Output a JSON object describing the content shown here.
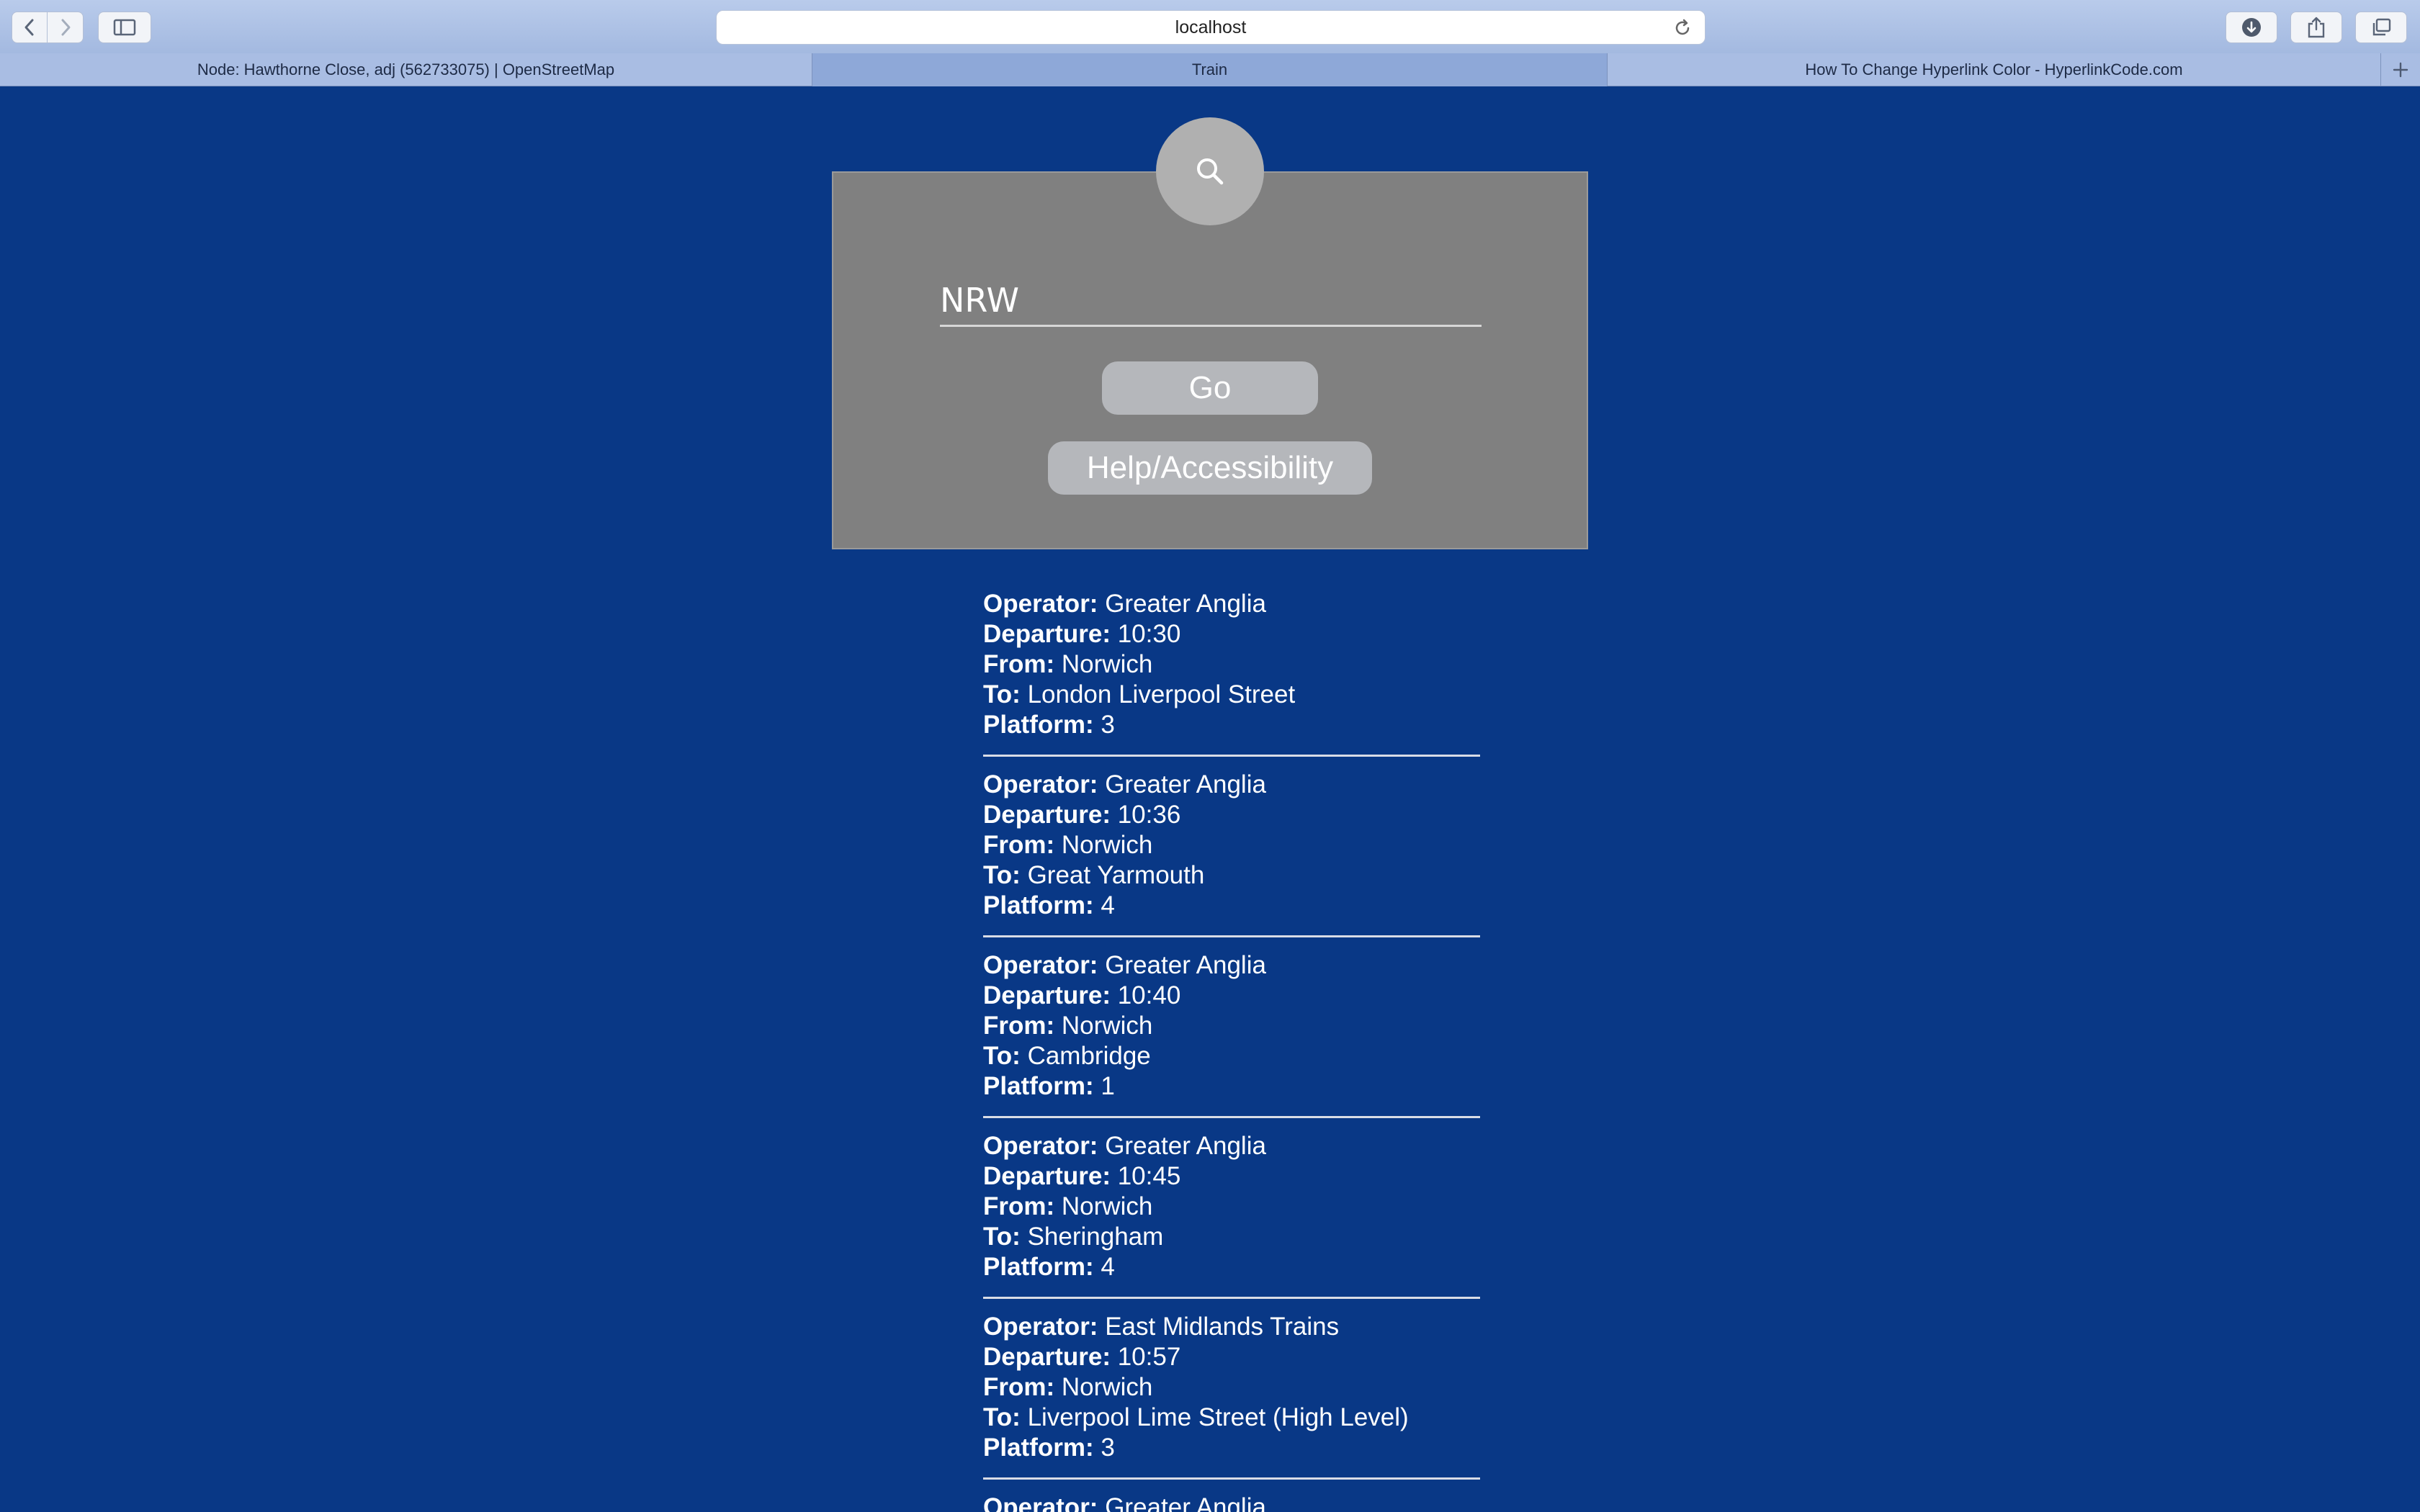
{
  "browser": {
    "address": "localhost",
    "tabs": [
      {
        "label": "Node: Hawthorne Close, adj (562733075) | OpenStreetMap",
        "active": false
      },
      {
        "label": "Train",
        "active": true
      },
      {
        "label": "How To Change Hyperlink Color - HyperlinkCode.com",
        "active": false
      }
    ]
  },
  "search": {
    "icon": "search-icon",
    "value": "NRW",
    "go_label": "Go",
    "help_label": "Help/Accessibility"
  },
  "labels": {
    "operator": "Operator:",
    "departure": "Departure:",
    "from": "From:",
    "to": "To:",
    "platform": "Platform:"
  },
  "departures": [
    {
      "operator": "Greater Anglia",
      "departure": "10:30",
      "from": "Norwich",
      "to": "London Liverpool Street",
      "platform": "3"
    },
    {
      "operator": "Greater Anglia",
      "departure": "10:36",
      "from": "Norwich",
      "to": "Great Yarmouth",
      "platform": "4"
    },
    {
      "operator": "Greater Anglia",
      "departure": "10:40",
      "from": "Norwich",
      "to": "Cambridge",
      "platform": "1"
    },
    {
      "operator": "Greater Anglia",
      "departure": "10:45",
      "from": "Norwich",
      "to": "Sheringham",
      "platform": "4"
    },
    {
      "operator": "East Midlands Trains",
      "departure": "10:57",
      "from": "Norwich",
      "to": "Liverpool Lime Street (High Level)",
      "platform": "3"
    },
    {
      "operator": "Greater Anglia",
      "departure": "",
      "from": "",
      "to": "",
      "platform": ""
    }
  ],
  "colors": {
    "page_background": "#093886",
    "panel": "#808080",
    "button": "#b5b7bb"
  }
}
